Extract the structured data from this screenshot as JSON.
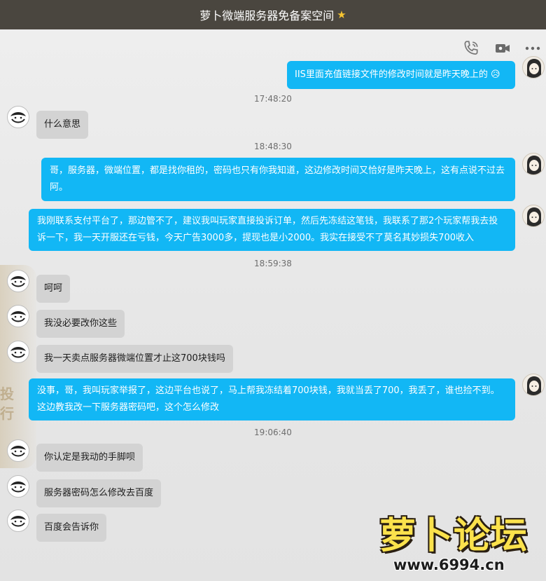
{
  "window": {
    "title": "萝卜微端服务器免备案空间",
    "title_icon": "star-icon"
  },
  "toolbar": {
    "icons": [
      "phone-icon",
      "video-icon",
      "more-icon"
    ]
  },
  "messages": [
    {
      "side": "right",
      "text": "IIS里面充值链接文件的修改时间就是昨天晚上的 😥"
    },
    {
      "type": "time",
      "text": "17:48:20"
    },
    {
      "side": "left",
      "text": "什么意思"
    },
    {
      "type": "time",
      "text": "18:48:30"
    },
    {
      "side": "right",
      "text": "哥，服务器，微端位置，都是找你租的，密码也只有你我知道，这边修改时间又恰好是昨天晚上，这有点说不过去阿。"
    },
    {
      "side": "right",
      "text": "我刚联系支付平台了，那边管不了，建议我叫玩家直接投诉订单，然后先冻结这笔钱，我联系了那2个玩家帮我去投诉一下，我一天开服还在亏钱，今天广告3000多，提现也是小2000。我实在接受不了莫名其妙损失700收入"
    },
    {
      "type": "time",
      "text": "18:59:38"
    },
    {
      "side": "left",
      "text": "呵呵"
    },
    {
      "side": "left",
      "text": "我没必要改你这些"
    },
    {
      "side": "left",
      "text": "我一天卖点服务器微端位置才止这700块钱吗"
    },
    {
      "side": "right",
      "text": "没事，哥，我叫玩家举报了，这边平台也说了，马上帮我冻结着700块钱，我就当丢了700，我丢了，谁也捡不到。这边教我改一下服务器密码吧，这个怎么修改"
    },
    {
      "type": "time",
      "text": "19:06:40"
    },
    {
      "side": "left",
      "text": "你认定是我动的手脚呗"
    },
    {
      "side": "left",
      "text": "服务器密码怎么修改去百度"
    },
    {
      "side": "left",
      "text": "百度会告诉你"
    }
  ],
  "background": {
    "side_text_1": "投",
    "side_text_2": "行"
  },
  "watermark": {
    "title": "萝卜论坛",
    "url": "www.6994.cn"
  },
  "colors": {
    "title_bar": "#4a463f",
    "right_bubble": "#12b7f5",
    "left_bubble": "#d3d3d3",
    "timestamp": "#6e6e6e"
  }
}
